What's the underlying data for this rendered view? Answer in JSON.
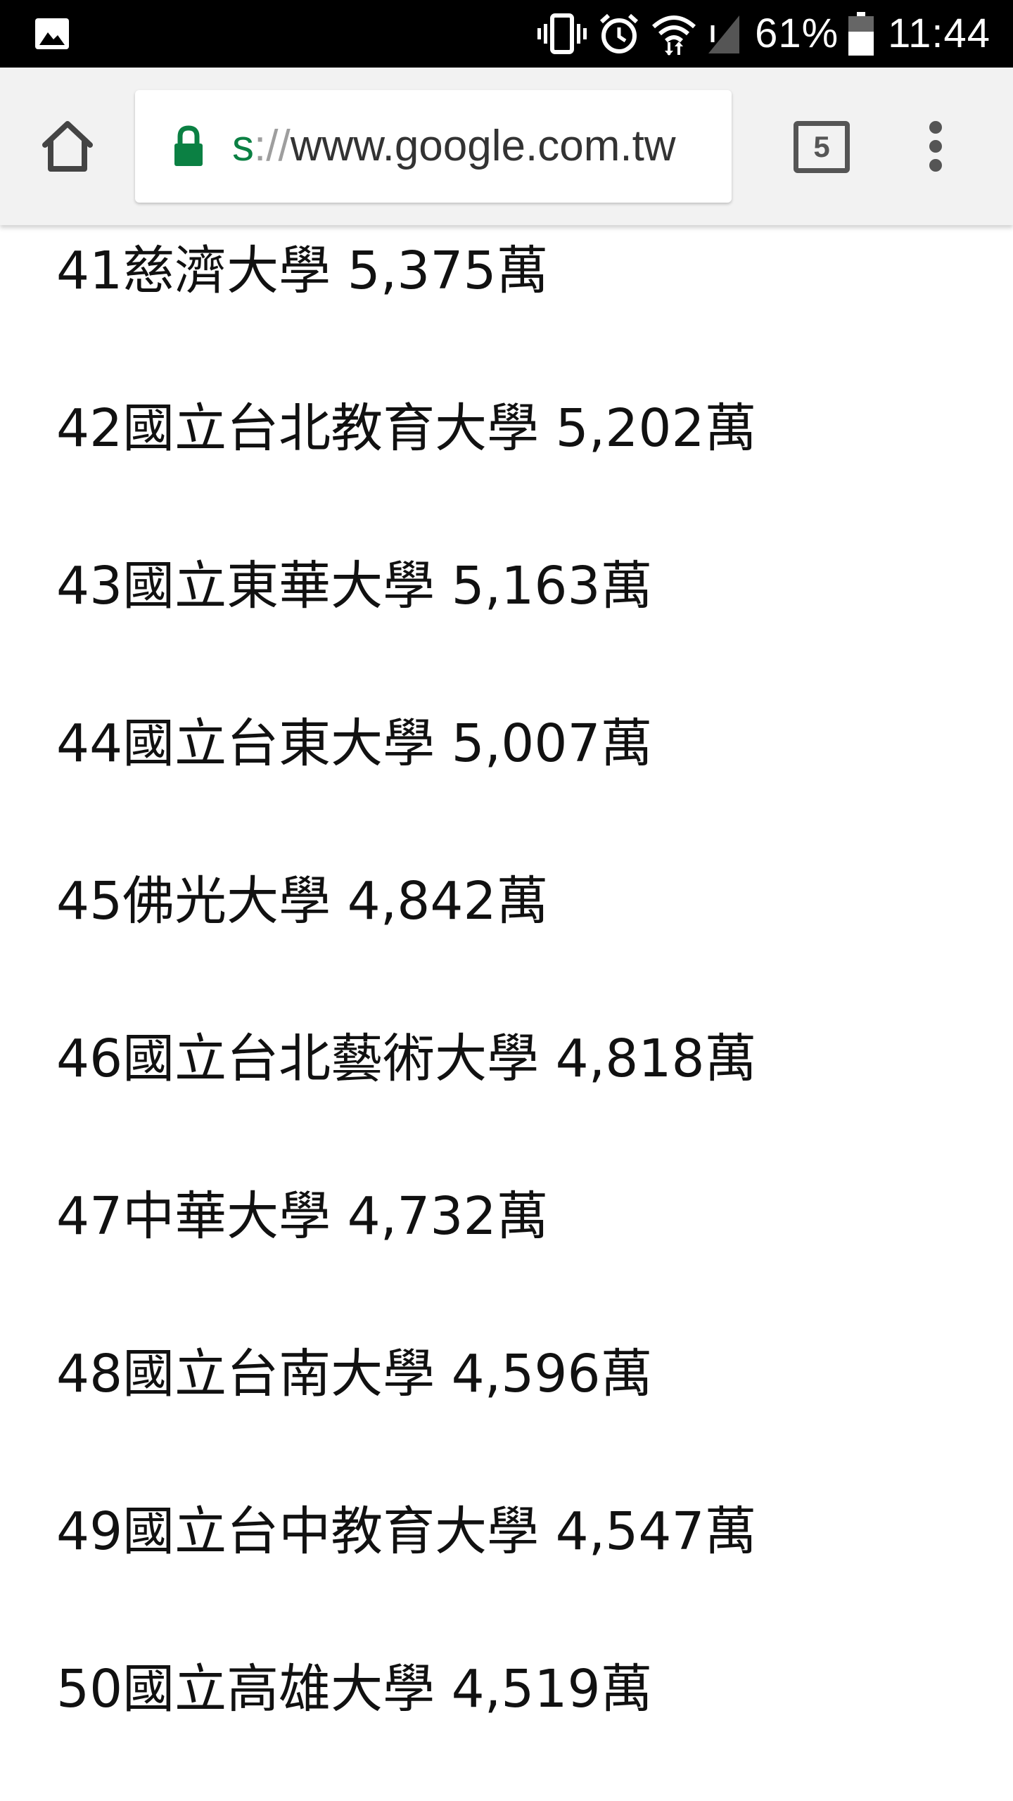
{
  "status_bar": {
    "battery_percent": "61%",
    "time": "11:44",
    "icons": [
      "image-notification-icon",
      "vibrate-icon",
      "alarm-icon",
      "wifi-icon",
      "signal-icon",
      "battery-icon"
    ]
  },
  "toolbar": {
    "url_scheme": "s",
    "url_separator": "://",
    "url_host": "www.google.com.tw",
    "tab_count": "5",
    "accent_color": "#0b8043"
  },
  "list": {
    "items": [
      {
        "text": "41慈濟大學 5,375萬"
      },
      {
        "text": "42國立台北教育大學 5,202萬"
      },
      {
        "text": "43國立東華大學 5,163萬"
      },
      {
        "text": "44國立台東大學 5,007萬"
      },
      {
        "text": "45佛光大學 4,842萬"
      },
      {
        "text": "46國立台北藝術大學 4,818萬"
      },
      {
        "text": "47中華大學 4,732萬"
      },
      {
        "text": "48國立台南大學 4,596萬"
      },
      {
        "text": "49國立台中教育大學 4,547萬"
      },
      {
        "text": "50國立高雄大學 4,519萬"
      }
    ]
  }
}
